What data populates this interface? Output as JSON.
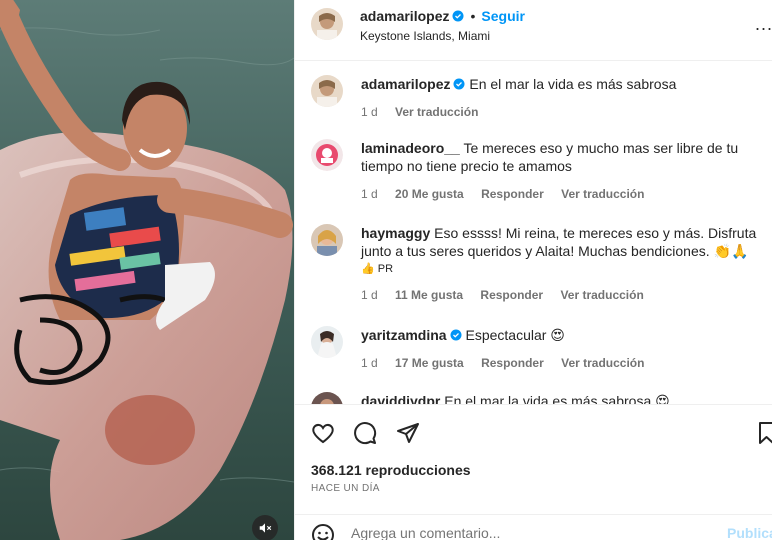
{
  "header": {
    "username": "adamarilopez",
    "separator": "•",
    "follow_label": "Seguir",
    "location": "Keystone Islands, Miami",
    "more_label": "..."
  },
  "caption": {
    "username": "adamarilopez",
    "text": "En el mar la vida es más sabrosa",
    "time": "1 d",
    "translate": "Ver traducción"
  },
  "comments": [
    {
      "username": "laminadeoro__",
      "text": "Te mereces eso y mucho mas ser libre de tu tiempo no tiene precio te amamos",
      "time": "1 d",
      "likes": "20 Me gusta",
      "reply": "Responder",
      "translate": "Ver traducción"
    },
    {
      "username": "haymaggy",
      "text": "Eso essss! Mi reina, te mereces eso y más. Disfruta junto a tus seres queridos y Alaita! Muchas bendiciones. 👏🙏",
      "text2": "👍 PR",
      "time": "1 d",
      "likes": "11 Me gusta",
      "reply": "Responder",
      "translate": "Ver traducción"
    },
    {
      "username": "yaritzamdina",
      "text": "Espectacular 😍",
      "time": "1 d",
      "likes": "17 Me gusta",
      "reply": "Responder",
      "translate": "Ver traducción"
    },
    {
      "username": "daviddiydpr",
      "text": "En el mar la vida es más sabrosa 😍"
    }
  ],
  "stats": {
    "views": "368.121 reproducciones",
    "time_ago": "HACE UN DÍA"
  },
  "add_comment": {
    "placeholder": "Agrega un comentario...",
    "post_label": "Publica"
  },
  "icons": {
    "like": "heart-icon",
    "comment": "comment-icon",
    "share": "share-icon",
    "save": "bookmark-icon",
    "emoji": "emoji-icon",
    "mute": "muted-speaker-icon",
    "verified": "verified-badge-icon"
  },
  "colors": {
    "accent": "#0095f6",
    "verified": "#0095f6",
    "secondary_text": "#737373",
    "post_button_disabled": "#b2dffc"
  }
}
